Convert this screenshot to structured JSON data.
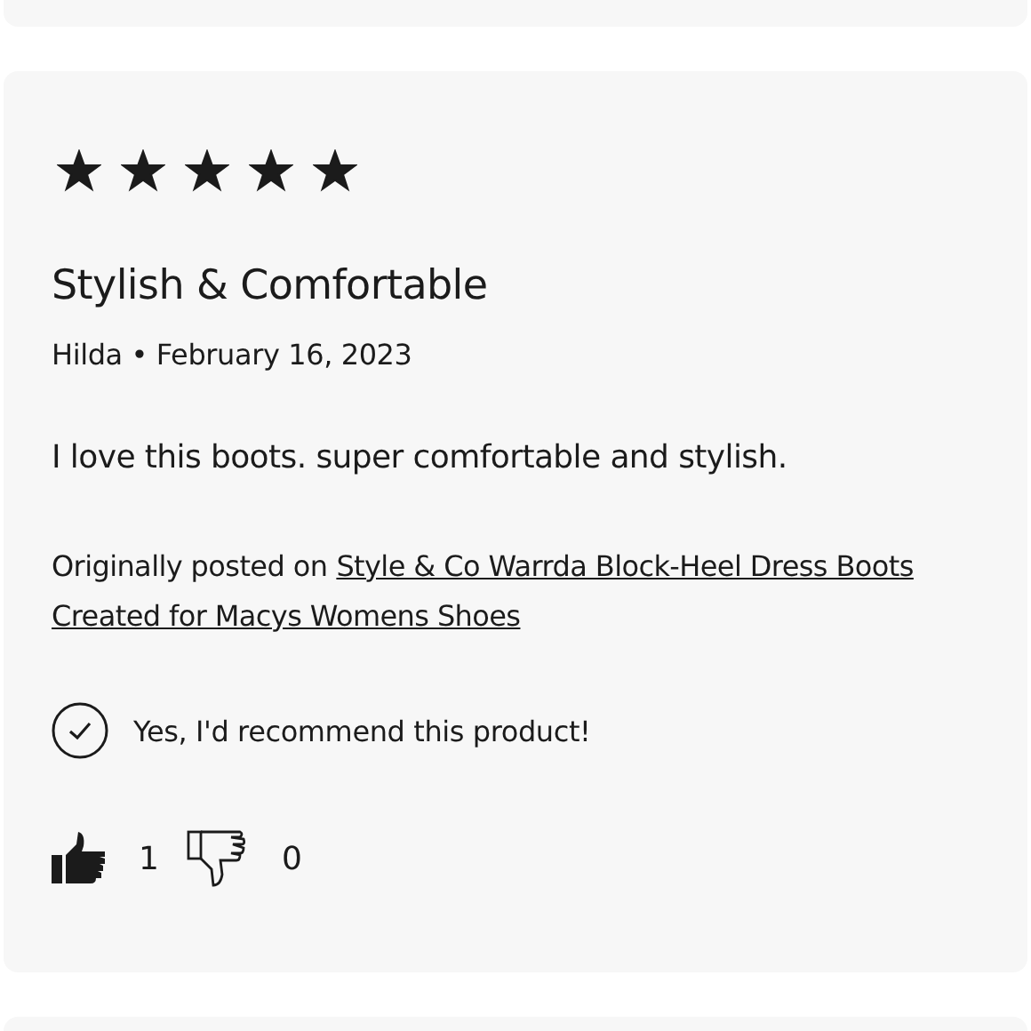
{
  "review": {
    "stars": 5,
    "title": "Stylish & Comfortable",
    "author": "Hilda",
    "separator": "•",
    "date": "February 16, 2023",
    "body": "I love this boots.  super comfortable and stylish.",
    "origin_prefix": "Originally posted on",
    "origin_link_lines": [
      "Style & Co Warrda Block-Heel Dress Boots",
      "Created for Macys Womens Shoes"
    ],
    "recommend": {
      "checked": true,
      "label": "Yes, I'd recommend this product!"
    },
    "helpful_count": "1",
    "unhelpful_count": "0"
  }
}
